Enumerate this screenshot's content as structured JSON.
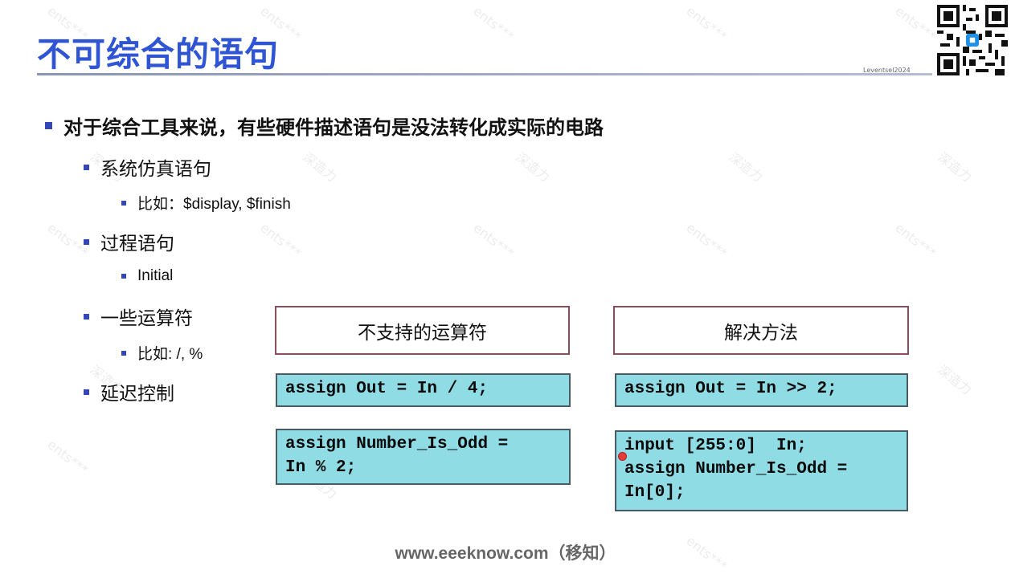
{
  "title": "不可综合的语句",
  "rule_caption": "Leventsel2024",
  "bullets": {
    "main": "对于综合工具来说，有些硬件描述语句是没法转化成实际的电路",
    "sys_sim": "系统仿真语句",
    "sys_sim_example": "比如：$display, $finish",
    "procedure": "过程语句",
    "procedure_example": "Initial",
    "operators": "一些运算符",
    "operators_example": "比如: /, %",
    "delay": "延迟控制"
  },
  "table": {
    "unsupported_header": "不支持的运算符",
    "solution_header": "解决方法",
    "unsupported_code_1": "assign Out = In / 4;",
    "solution_code_1": "assign Out = In >> 2;",
    "unsupported_code_2": "assign Number_Is_Odd =\nIn % 2;",
    "solution_code_2": "input [255:0]  In;\nassign Number_Is_Odd =\nIn[0];"
  },
  "footer": "www.eeeknow.com（移知）",
  "watermark": [
    "ents***",
    "深造力"
  ],
  "colors": {
    "title": "#2f55d4",
    "bullet": "#3546b8",
    "code_bg": "#8fdce4",
    "header_border": "#8a4d5c"
  }
}
